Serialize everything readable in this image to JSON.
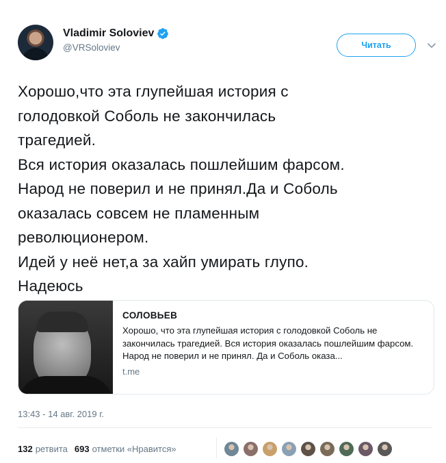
{
  "user": {
    "display_name": "Vladimir Soloviev",
    "handle": "@VRSoloviev",
    "verified": true
  },
  "follow_button_label": "Читать",
  "tweet_text": "Хорошо,что эта глупейшая история с\nголодовкой Соболь не закончилась\nтрагедией.\nВся история оказалась пошлейшим фарсом.\nНарод не поверил и не принял.Да и Соболь\nоказалась совсем не пламенным\nреволюционером.\nИдей у неё нет,а за хайп умирать глупо.\nНадеюсь",
  "card": {
    "title": "СОЛОВЬЕВ",
    "description": "Хорошо, что эта глупейшая история с голодовкой Соболь не закончилась трагедией. Вся история оказалась пошлейшим фарсом. Народ не поверил и не принял. Да и Соболь оказа...",
    "domain": "t.me"
  },
  "timestamp": "13:43 - 14 авг. 2019 г.",
  "stats": {
    "retweets_count": "132",
    "retweets_label": "ретвита",
    "likes_count": "693",
    "likes_label": "отметки «Нравится»"
  },
  "likers_colors": [
    "#6f8796",
    "#8a6f6a",
    "#c9a06a",
    "#8aa0b4",
    "#5d5148",
    "#7a6a58",
    "#4f6b58",
    "#6a5866",
    "#585858"
  ],
  "colors": {
    "accent": "#1da1f2",
    "secondary_text": "#657786"
  },
  "icons": {
    "verified": "verified-badge-icon",
    "menu": "chevron-down-icon"
  }
}
